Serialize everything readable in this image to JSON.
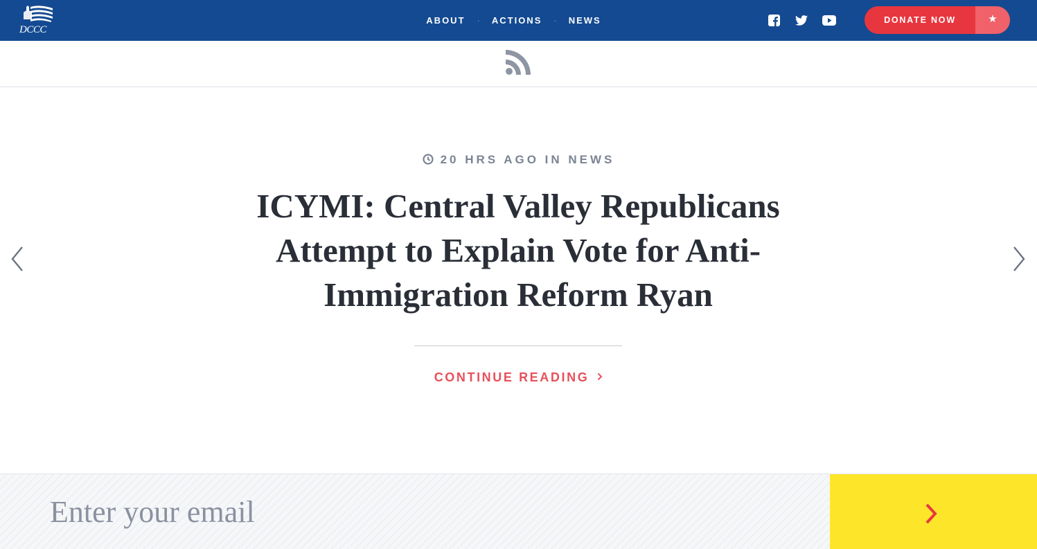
{
  "header": {
    "logo_text": "DCCC",
    "nav": [
      {
        "label": "ABOUT"
      },
      {
        "label": "ACTIONS"
      },
      {
        "label": "NEWS"
      }
    ],
    "nav_separator": "·",
    "social": [
      "facebook-icon",
      "twitter-icon",
      "youtube-icon"
    ],
    "donate_label": "DONATE NOW",
    "donate_icon": "★"
  },
  "feed": {
    "icon": "rss-icon"
  },
  "post": {
    "meta": "20 HRS AGO IN NEWS",
    "title": "ICYMI: Central Valley Republicans Attempt to Explain Vote for Anti-Immigration Reform Ryan",
    "continue_label": "CONTINUE READING"
  },
  "signup": {
    "placeholder": "Enter your email"
  },
  "colors": {
    "header_bg": "#144a91",
    "donate_red": "#e8363f",
    "accent_red": "#e8505b",
    "submit_yellow": "#fde52a"
  }
}
